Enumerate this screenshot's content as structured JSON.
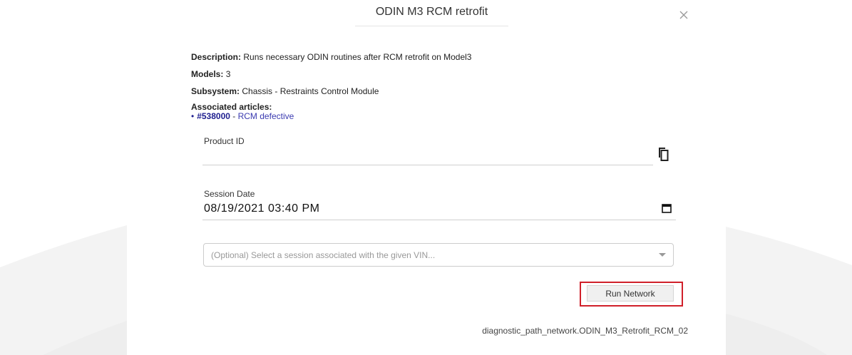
{
  "modal": {
    "title": "ODIN M3 RCM retrofit"
  },
  "info": {
    "description_label": "Description:",
    "description_value": "Runs necessary ODIN routines after RCM retrofit on Model3",
    "models_label": "Models:",
    "models_value": "3",
    "subsystem_label": "Subsystem:",
    "subsystem_value": "Chassis - Restraints Control Module",
    "associated_label": "Associated articles:",
    "articles": [
      {
        "id": "#538000",
        "separator": " - ",
        "title": "RCM defective"
      }
    ]
  },
  "form": {
    "product_id_label": "Product ID",
    "product_id_value": "",
    "session_date_label": "Session Date",
    "session_date_value": "08/19/2021 03:40 PM",
    "session_select_placeholder": "(Optional) Select a session associated with the given VIN..."
  },
  "actions": {
    "run_label": "Run Network"
  },
  "footer": {
    "network_id": "diagnostic_path_network.ODIN_M3_Retrofit_RCM_02"
  },
  "colors": {
    "highlight": "#d0202a",
    "link": "#1e1e8f",
    "background_swoosh": "#f2f2f2"
  },
  "icons": [
    "close-icon",
    "copy-icon",
    "calendar-icon",
    "chevron-down-icon"
  ]
}
